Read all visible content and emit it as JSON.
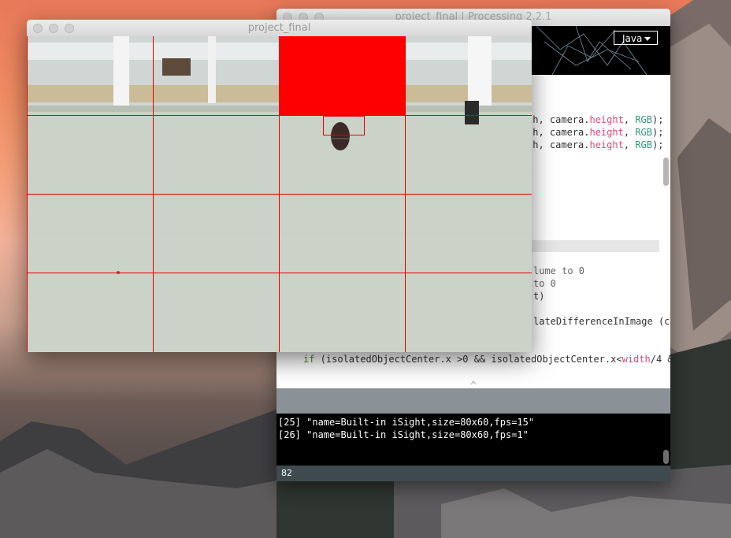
{
  "ide": {
    "title": "project_final | Processing 2.2.1",
    "mode": "Java",
    "code": {
      "line1_a": "th, camera.",
      "line1_b": "height",
      "line1_c": ", ",
      "line1_d": "RGB",
      "line1_e": ");",
      "line2_a": "th, camera.",
      "line2_b": "height",
      "line2_c": ", ",
      "line2_d": "RGB",
      "line2_e": ");",
      "line3_a": "th, camera.",
      "line3_b": "height",
      "line3_c": ", ",
      "line3_d": "RGB",
      "line3_e": ");",
      "comment1": "lume to 0",
      "comment2": "to 0",
      "line_t": "t)",
      "line_iso": "lateDifferenceInImage (c",
      "if_kw": "if",
      "if_rest": " (isolatedObjectCenter.x >0 && isolatedObjectCenter.x<",
      "if_width": "width",
      "if_tail": "/4 &"
    },
    "console": {
      "line1": "[25] \"name=Built-in iSight,size=80x60,fps=15\"",
      "line2": "[26] \"name=Built-in iSight,size=80x60,fps=1\""
    },
    "status_line": "82"
  },
  "sketch": {
    "title": "project_final"
  },
  "colors": {
    "grid": "#e00000",
    "active_cell": "#ff0000"
  }
}
